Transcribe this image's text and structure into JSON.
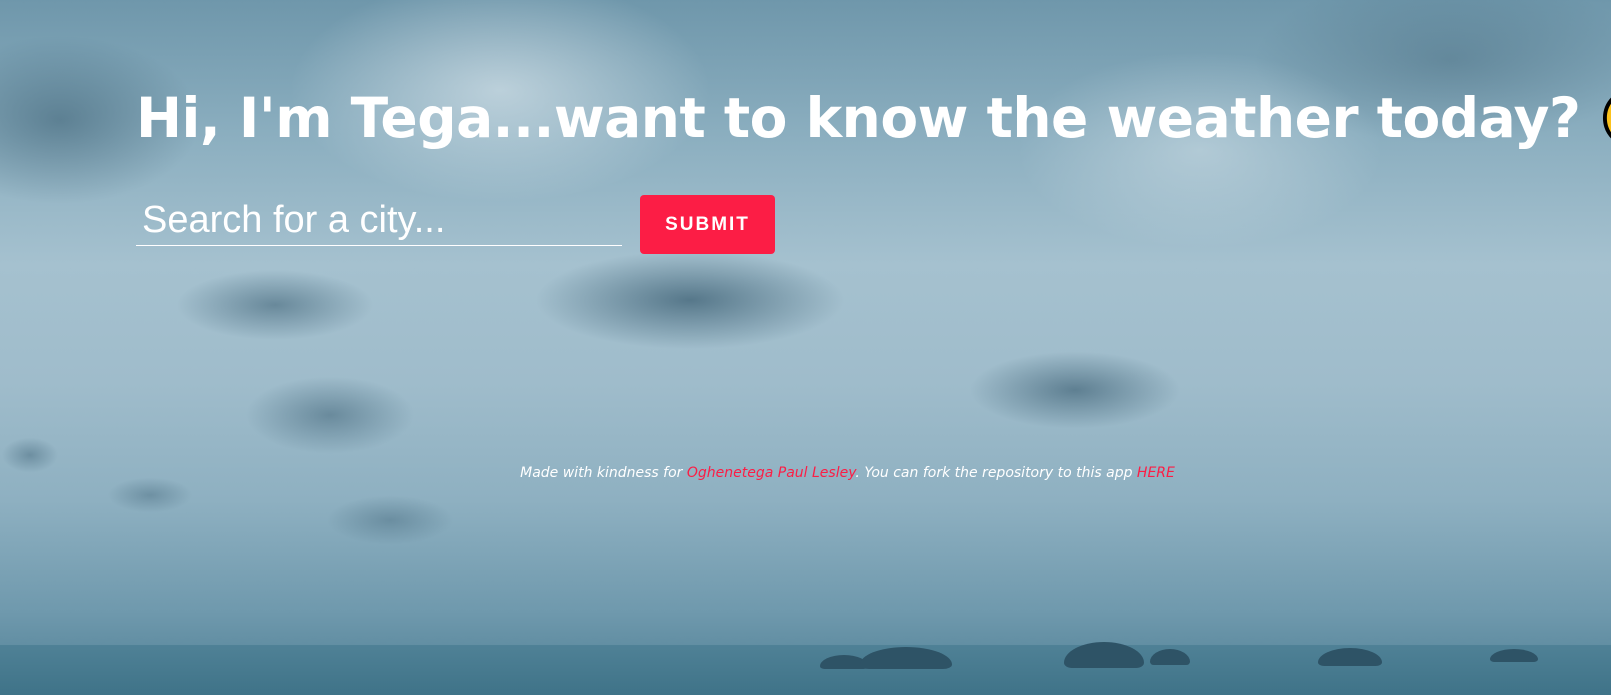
{
  "header": {
    "heading": "Hi, I'm Tega...want to know the weather today?",
    "emoji_icon": "smiley-face-icon"
  },
  "search": {
    "placeholder": "Search for a city...",
    "value": ""
  },
  "submit": {
    "label": "SUBMIT"
  },
  "footer": {
    "prefix": "Made with kindness for ",
    "author_link": "Oghenetega Paul Lesley",
    "middle": ". You can fork the repository to this app ",
    "repo_link": "HERE"
  },
  "colors": {
    "accent": "#fc1d45",
    "text": "#ffffff",
    "smiley_fill": "#fcc21b",
    "smiley_stroke": "#000000"
  }
}
